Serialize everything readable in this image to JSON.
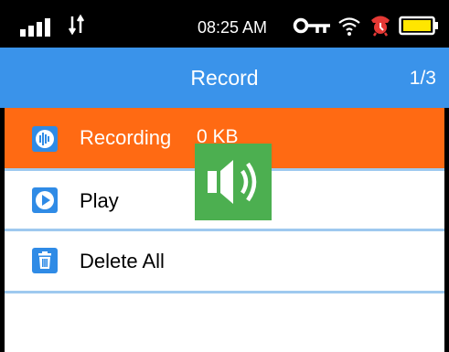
{
  "status_bar": {
    "time": "08:25 AM",
    "icons": [
      "signal-icon",
      "data-arrows-icon",
      "key-icon",
      "wifi-icon",
      "alarm-icon",
      "battery-icon"
    ]
  },
  "header": {
    "title": "Record",
    "page_indicator": "1/3"
  },
  "menu": {
    "items": [
      {
        "label": "Recording",
        "value": "0 KB",
        "icon": "audio-wave-icon",
        "selected": true
      },
      {
        "label": "Play",
        "icon": "play-icon"
      },
      {
        "label": "Delete All",
        "icon": "trash-icon"
      }
    ]
  },
  "overlay": {
    "icon": "speaker-icon"
  },
  "colors": {
    "status_bar": "#000000",
    "title_bar": "#3a93ea",
    "selected_row": "#ff6a13",
    "divider": "#9ec9ef",
    "icon_blue": "#2f8be6",
    "speaker_bg": "#4caf50",
    "battery_fill": "#ffe600"
  }
}
